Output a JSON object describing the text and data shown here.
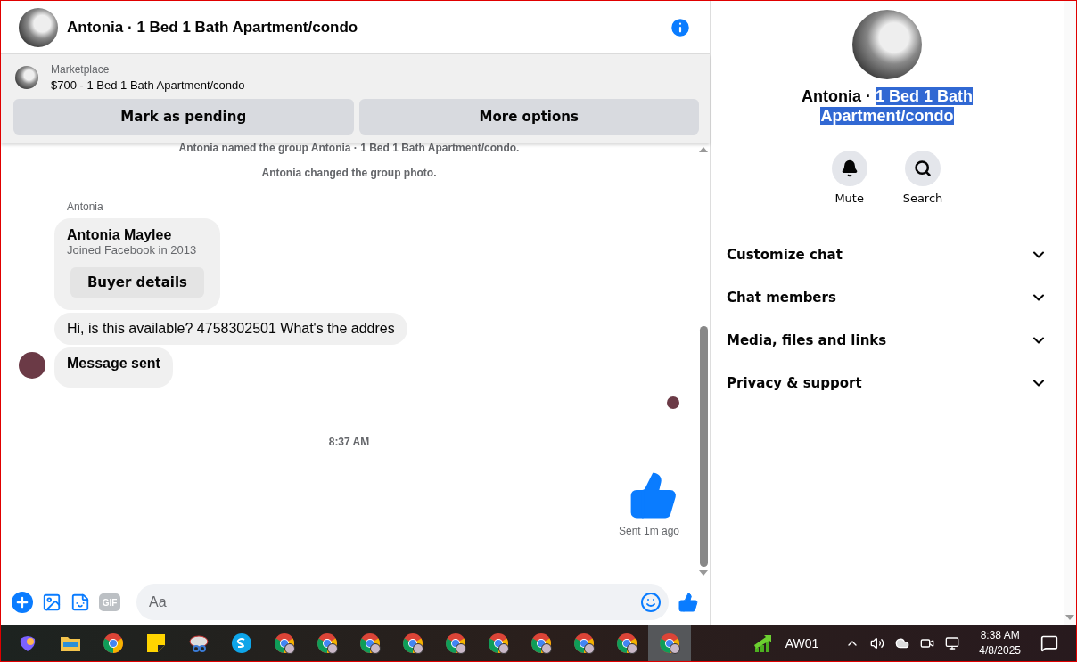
{
  "chat_header": {
    "title": "Antonia · 1 Bed 1 Bath Apartment/condo"
  },
  "listing": {
    "source": "Marketplace",
    "title": "$700 - 1 Bed 1 Bath Apartment/condo",
    "actions": [
      "Mark as pending",
      "More options"
    ]
  },
  "messages": [
    {
      "kind": "event",
      "text": "Antonia named the group Antonia · 1 Bed 1 Bath Apartment/condo."
    },
    {
      "kind": "event",
      "text": "Antonia changed the group photo."
    },
    {
      "kind": "sender",
      "text": "Antonia"
    },
    {
      "kind": "profile",
      "name": "Antonia Maylee",
      "subtitle": "Joined Facebook in 2013",
      "action": "Buyer details"
    },
    {
      "kind": "bubble",
      "text": "Hi, is this available? 4758302501 What's the addres",
      "avatar": false,
      "bold": false
    },
    {
      "kind": "bubble",
      "text": "Message sent",
      "avatar": true,
      "bold": true
    },
    {
      "kind": "seen"
    },
    {
      "kind": "time",
      "text": "8:37 AM"
    },
    {
      "kind": "like"
    },
    {
      "kind": "status",
      "text": "Sent 1m ago"
    }
  ],
  "composer": {
    "gif_label": "GIF",
    "placeholder": "Aa"
  },
  "details": {
    "name": "Antonia · ",
    "selected_text": "1 Bed 1 Bath Apartment/condo",
    "actions": [
      {
        "kind": "mute",
        "label": "Mute"
      },
      {
        "kind": "search",
        "label": "Search"
      }
    ],
    "sections": [
      {
        "label": "Customize chat",
        "expanded": false
      },
      {
        "label": "Chat members",
        "expanded": false
      },
      {
        "label": "Media, files and links",
        "expanded": false
      },
      {
        "label": "Privacy & support",
        "expanded": false
      }
    ]
  },
  "taskbar": {
    "apps": [
      {
        "kind": "copilot",
        "active": false
      },
      {
        "kind": "folder",
        "active": false
      },
      {
        "kind": "chrome",
        "active": false
      },
      {
        "kind": "notes",
        "active": false
      },
      {
        "kind": "snip",
        "active": false
      },
      {
        "kind": "skype",
        "active": false
      },
      {
        "kind": "chrome-profile",
        "active": false
      },
      {
        "kind": "chrome-profile",
        "active": false
      },
      {
        "kind": "chrome-profile",
        "active": false
      },
      {
        "kind": "chrome-profile",
        "active": false
      },
      {
        "kind": "chrome-profile",
        "active": false
      },
      {
        "kind": "chrome-profile",
        "active": false
      },
      {
        "kind": "chrome-profile",
        "active": false
      },
      {
        "kind": "chrome-profile",
        "active": false
      },
      {
        "kind": "chrome-profile",
        "active": false
      },
      {
        "kind": "chrome-profile",
        "active": true
      }
    ],
    "network": "AW01",
    "time": "8:38 AM",
    "date": "4/8/2025"
  }
}
